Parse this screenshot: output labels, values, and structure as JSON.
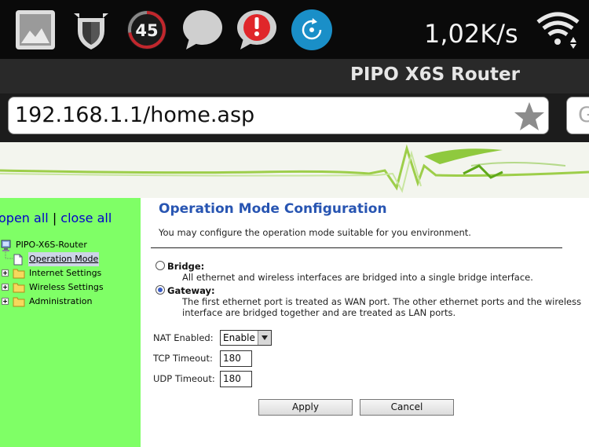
{
  "status_bar": {
    "icons": [
      "gallery-icon",
      "shield-helmet-icon",
      "speed-45-icon",
      "chat-bubble-icon",
      "alert-icon",
      "sync-icon",
      "wifi-icon"
    ],
    "speed_badge": "45",
    "net_speed": "1,02K/s",
    "colors": {
      "badge_red": "#c1272d",
      "alert_red": "#e0262a",
      "sync_blue": "#1a8fc8"
    }
  },
  "browser": {
    "title": "PIPO X6S Router",
    "url": "192.168.1.1/home.asp",
    "search_partial": "G"
  },
  "sidebar": {
    "open_all": "open all",
    "separator": "|",
    "close_all": "close all",
    "tree": {
      "root": "PIPO-X6S-Router",
      "items": [
        {
          "label": "Operation Mode",
          "selected": true
        },
        {
          "label": "Internet Settings"
        },
        {
          "label": "Wireless Settings"
        },
        {
          "label": "Administration"
        }
      ]
    },
    "color": "#7fff66"
  },
  "content": {
    "title": "Operation Mode Configuration",
    "description": "You may configure the operation mode suitable for you environment.",
    "options": [
      {
        "label": "Bridge:",
        "desc": [
          "All ethernet and wireless interfaces are bridged into a single bridge interface."
        ],
        "checked": false
      },
      {
        "label": "Gateway:",
        "desc": [
          "The first ethernet port is treated as WAN port. The other ethernet ports and the wireless",
          "interface are bridged together and are treated as LAN ports."
        ],
        "checked": true
      }
    ],
    "nat_label": "NAT Enabled:",
    "nat_value": "Enable",
    "tcp_label": "TCP Timeout:",
    "tcp_value": "180",
    "udp_label": "UDP Timeout:",
    "udp_value": "180",
    "apply": "Apply",
    "cancel": "Cancel"
  }
}
